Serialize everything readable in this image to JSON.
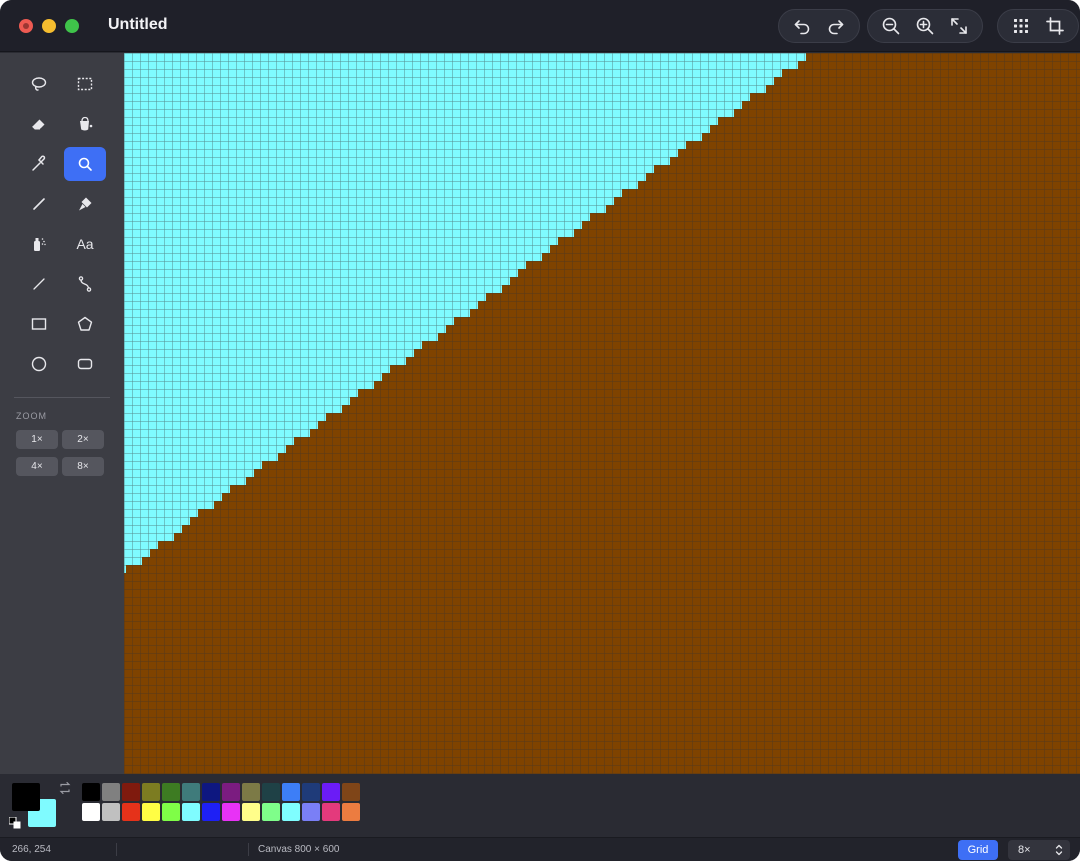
{
  "window": {
    "title": "Untitled"
  },
  "toolbar": {
    "history": [
      "undo-icon",
      "redo-icon"
    ],
    "view": [
      "zoom-out-icon",
      "zoom-in-icon",
      "fit-screen-icon"
    ],
    "extra": [
      "grid-icon",
      "crop-icon"
    ]
  },
  "sidebar": {
    "tools": [
      {
        "name": "lasso",
        "icon": "lasso-icon"
      },
      {
        "name": "rect-select",
        "icon": "rect-select-icon"
      },
      {
        "name": "eraser",
        "icon": "eraser-icon"
      },
      {
        "name": "fill",
        "icon": "fill-bucket-icon"
      },
      {
        "name": "eyedropper",
        "icon": "eyedropper-icon"
      },
      {
        "name": "magnifier",
        "icon": "magnifier-icon",
        "active": true
      },
      {
        "name": "pencil",
        "icon": "pencil-icon"
      },
      {
        "name": "brush",
        "icon": "brush-icon"
      },
      {
        "name": "airbrush",
        "icon": "airbrush-icon"
      },
      {
        "name": "text",
        "label": "Aa"
      },
      {
        "name": "line",
        "icon": "line-icon"
      },
      {
        "name": "curve",
        "icon": "curve-icon"
      },
      {
        "name": "rectangle",
        "icon": "rectangle-icon"
      },
      {
        "name": "polygon",
        "icon": "polygon-icon"
      },
      {
        "name": "ellipse",
        "icon": "ellipse-icon"
      },
      {
        "name": "rounded-rect",
        "icon": "rounded-rect-icon"
      }
    ],
    "zoom_label": "ZOOM",
    "zoom_buttons": [
      "1×",
      "2×",
      "4×",
      "8×"
    ]
  },
  "canvas": {
    "colors": {
      "upper": "#7ffbff",
      "lower": "#7f4300",
      "grid": "#333333"
    },
    "zoom": "8×"
  },
  "colors": {
    "primary": "#000000",
    "secondary": "#7ffbff",
    "palette": [
      "#000000",
      "#808080",
      "#7f1a0e",
      "#7c7c21",
      "#3d7b22",
      "#3f7b7b",
      "#0e1780",
      "#7b1c80",
      "#7c7a46",
      "#1f4146",
      "#3d7ef7",
      "#1f3b79",
      "#6b1cf6",
      "#7f4518",
      "#ffffff",
      "#c0c0c0",
      "#e5321a",
      "#fffe44",
      "#7ffe47",
      "#7ffcff",
      "#1e20f5",
      "#e832f6",
      "#fffe8a",
      "#7ffe8a",
      "#7ffeff",
      "#7a7ff6",
      "#e43a7c",
      "#ec7c40"
    ]
  },
  "status": {
    "cursor": "266, 254",
    "canvas_size": "Canvas 800 × 600",
    "grid_label": "Grid",
    "zoom_value": "8×"
  }
}
